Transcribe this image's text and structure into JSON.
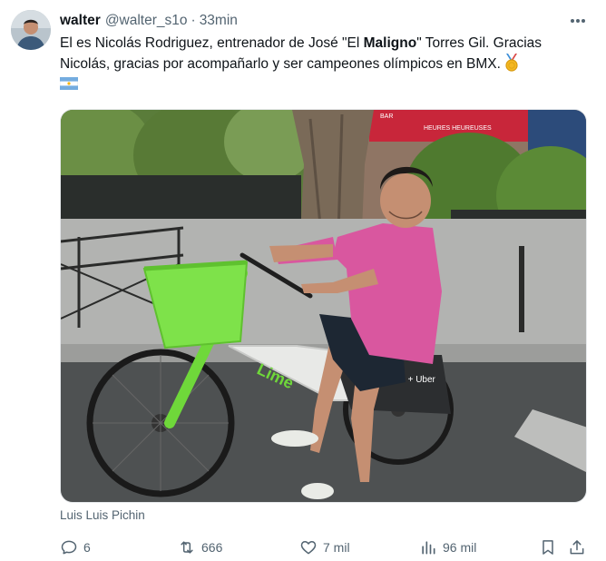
{
  "tweet": {
    "display_name": "walter",
    "handle": "@walter_s1o",
    "separator": "·",
    "time": "33min",
    "text_part1": "El es Nicolás Rodriguez, entrenador de José \"El ",
    "text_bold": "Maligno",
    "text_part2": "\" Torres Gil. Gracias Nicolás, gracias por acompañarlo y ser campeones olímpicos en BMX.",
    "medal_icon": "gold-medal-icon",
    "flag_icon": "argentina-flag-icon"
  },
  "media": {
    "alt": "Man in pink t-shirt riding a green Lime bike on a Paris street",
    "bike_brand": "Lime",
    "bike_panel": "On Lime + Uber",
    "cafe_sign": "HEURES HEUREUSES",
    "bar_sign": "BAR"
  },
  "caption": "Luis Luis Pichin",
  "actions": {
    "replies": "6",
    "retweets": "666",
    "likes": "7 mil",
    "views": "96 mil"
  },
  "colors": {
    "text": "#0f1419",
    "secondary": "#536471",
    "lime_green": "#6fd83a",
    "shirt_pink": "#d9579f"
  }
}
